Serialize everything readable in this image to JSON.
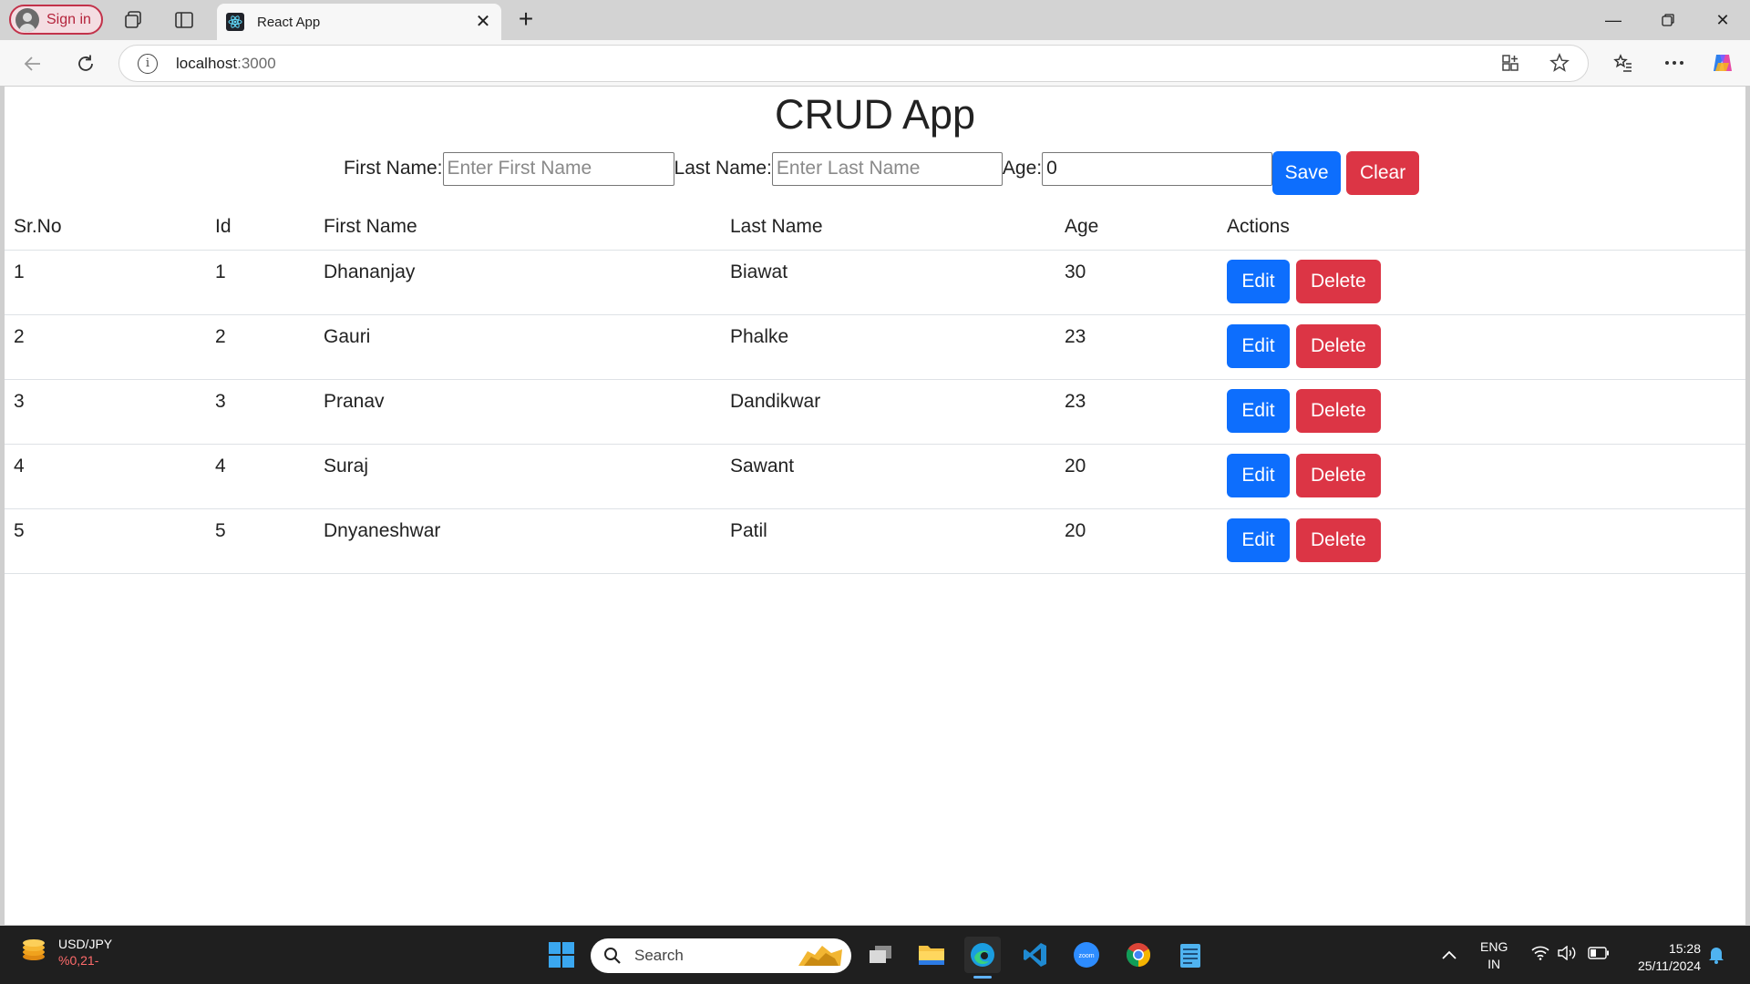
{
  "browser": {
    "signin_label": "Sign in",
    "tab_title": "React App",
    "url_host": "localhost",
    "url_port": ":3000"
  },
  "page": {
    "title": "CRUD App",
    "form": {
      "first_name_label": "First Name:",
      "first_name_placeholder": "Enter First Name",
      "first_name_value": "",
      "last_name_label": "Last Name:",
      "last_name_placeholder": "Enter Last Name",
      "last_name_value": "",
      "age_label": "Age:",
      "age_value": "0",
      "save_label": "Save",
      "clear_label": "Clear"
    },
    "table": {
      "columns": [
        "Sr.No",
        "Id",
        "First Name",
        "Last Name",
        "Age",
        "Actions"
      ],
      "rows": [
        {
          "srno": "1",
          "id": "1",
          "first": "Dhananjay",
          "last": "Biawat",
          "age": "30"
        },
        {
          "srno": "2",
          "id": "2",
          "first": "Gauri",
          "last": "Phalke",
          "age": "23"
        },
        {
          "srno": "3",
          "id": "3",
          "first": "Pranav",
          "last": "Dandikwar",
          "age": "23"
        },
        {
          "srno": "4",
          "id": "4",
          "first": "Suraj",
          "last": "Sawant",
          "age": "20"
        },
        {
          "srno": "5",
          "id": "5",
          "first": "Dnyaneshwar",
          "last": "Patil",
          "age": "20"
        }
      ],
      "edit_label": "Edit",
      "delete_label": "Delete"
    }
  },
  "taskbar": {
    "ticker_symbol": "USD/JPY",
    "ticker_change": "%0,21-",
    "search_label": "Search",
    "lang_line1": "ENG",
    "lang_line2": "IN",
    "time": "15:28",
    "date": "25/11/2024"
  },
  "colors": {
    "primary": "#0d6efd",
    "danger": "#dc3545",
    "taskbar": "#1f1f1f"
  }
}
